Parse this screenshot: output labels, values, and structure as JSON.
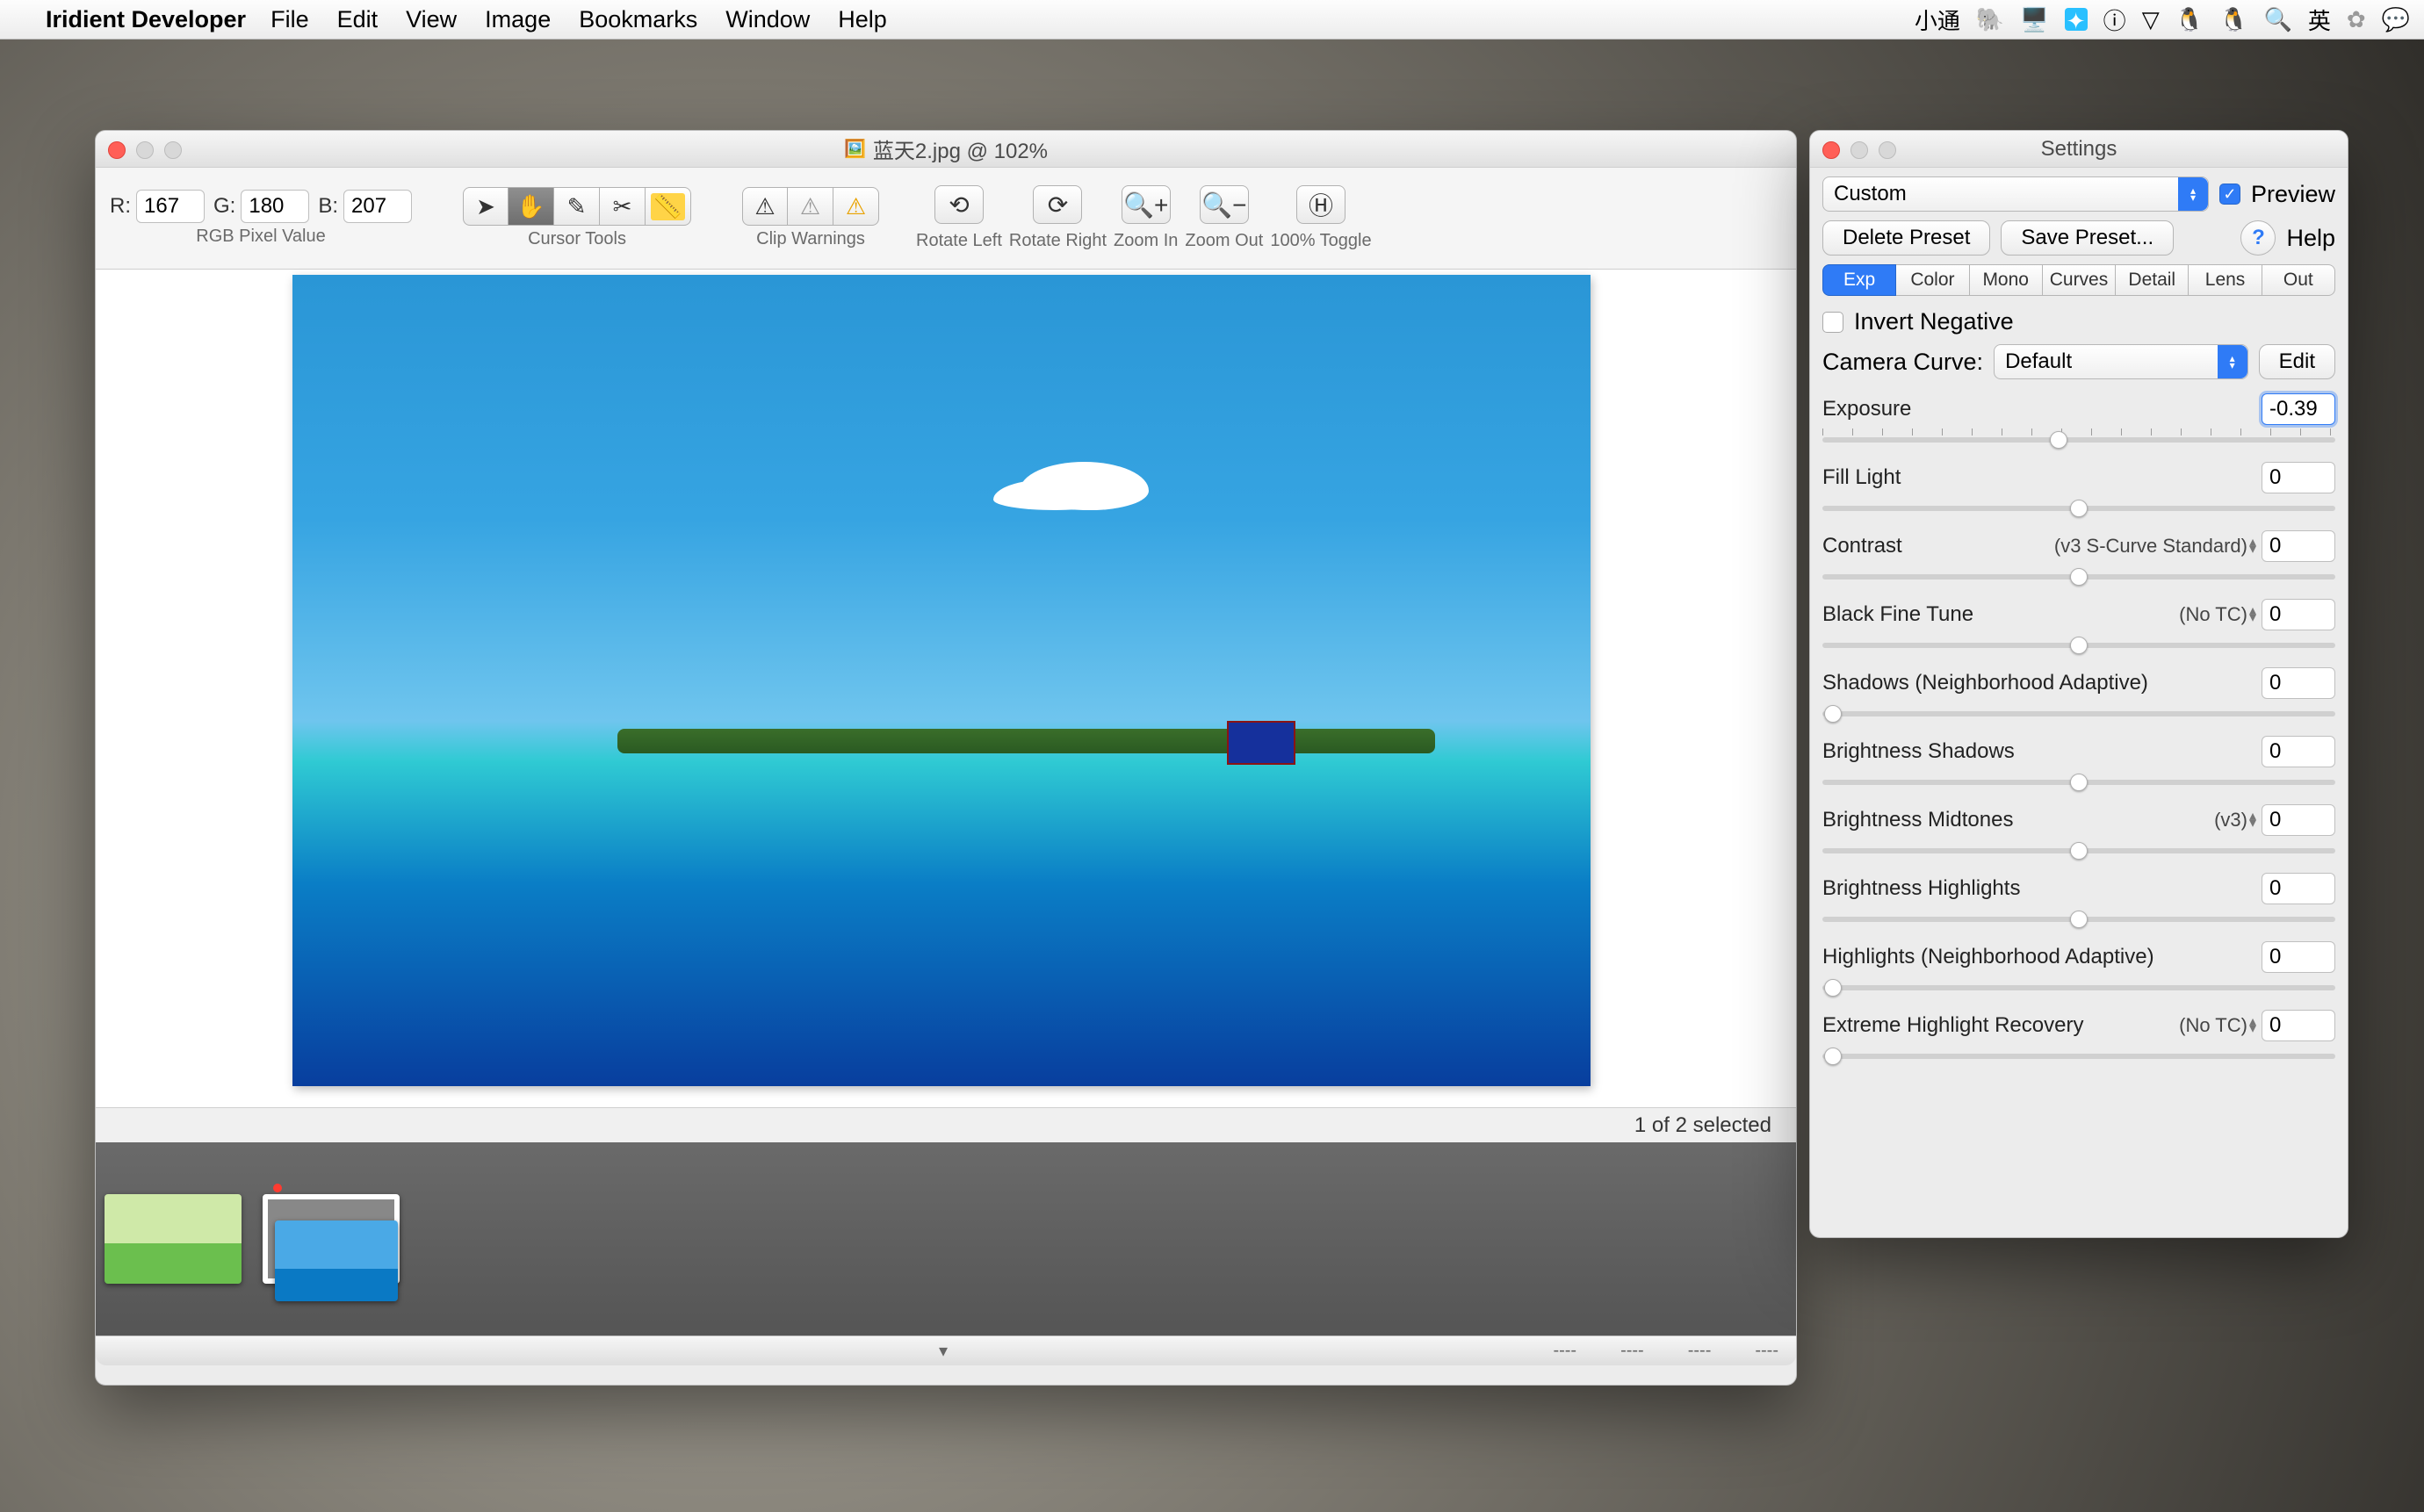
{
  "menubar": {
    "app": "Iridient Developer",
    "items": [
      "File",
      "Edit",
      "View",
      "Image",
      "Bookmarks",
      "Window",
      "Help"
    ],
    "status": [
      "小通",
      "英"
    ]
  },
  "mainWindow": {
    "title": "蓝天2.jpg @ 102%",
    "rgb": {
      "rLabel": "R:",
      "r": "167",
      "gLabel": "G:",
      "g": "180",
      "bLabel": "B:",
      "b": "207",
      "caption": "RGB Pixel Value"
    },
    "cursorCaption": "Cursor Tools",
    "clipCaption": "Clip Warnings",
    "actions": {
      "rotateLeft": "Rotate Left",
      "rotateRight": "Rotate Right",
      "zoomIn": "Zoom In",
      "zoomOut": "Zoom Out",
      "toggle100": "100% Toggle"
    },
    "statusStrip": "1 of 2 selected",
    "footerPlaceholders": [
      "----",
      "----",
      "----",
      "----"
    ]
  },
  "settings": {
    "title": "Settings",
    "preset": "Custom",
    "previewLabel": "Preview",
    "deletePreset": "Delete Preset",
    "savePreset": "Save Preset...",
    "help": "Help",
    "tabs": [
      "Exp",
      "Color",
      "Mono",
      "Curves",
      "Detail",
      "Lens",
      "Out"
    ],
    "invertNegative": "Invert Negative",
    "cameraCurveLabel": "Camera Curve:",
    "cameraCurve": "Default",
    "edit": "Edit",
    "params": [
      {
        "label": "Exposure",
        "sub": "",
        "value": "-0.39",
        "pos": 46,
        "ticks": true,
        "active": true
      },
      {
        "label": "Fill Light",
        "sub": "",
        "value": "0",
        "pos": 50
      },
      {
        "label": "Contrast",
        "sub": "(v3 S-Curve Standard)",
        "value": "0",
        "pos": 50,
        "stepper": true
      },
      {
        "label": "Black Fine Tune",
        "sub": "(No TC)",
        "value": "0",
        "pos": 50,
        "stepper": true
      },
      {
        "label": "Shadows (Neighborhood Adaptive)",
        "sub": "",
        "value": "0",
        "pos": 2
      },
      {
        "label": "Brightness Shadows",
        "sub": "",
        "value": "0",
        "pos": 50
      },
      {
        "label": "Brightness Midtones",
        "sub": "(v3)",
        "value": "0",
        "pos": 50,
        "stepper": true
      },
      {
        "label": "Brightness Highlights",
        "sub": "",
        "value": "0",
        "pos": 50
      },
      {
        "label": "Highlights (Neighborhood Adaptive)",
        "sub": "",
        "value": "0",
        "pos": 2
      },
      {
        "label": "Extreme Highlight Recovery",
        "sub": "(No TC)",
        "value": "0",
        "pos": 2,
        "stepper": true
      }
    ]
  }
}
